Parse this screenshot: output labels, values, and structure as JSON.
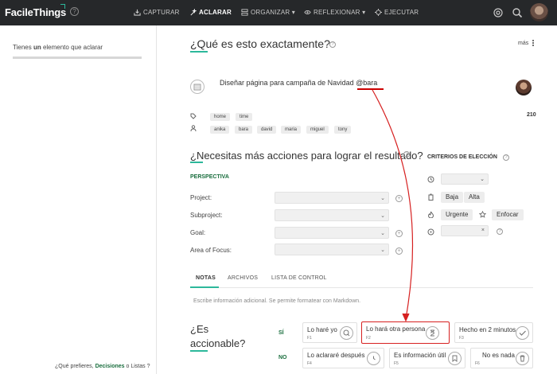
{
  "app": {
    "logo": "FacileThings"
  },
  "nav": {
    "capturar": "CAPTURAR",
    "aclarar": "ACLARAR",
    "organizar": "ORGANIZAR",
    "reflexionar": "REFLEXIONAR",
    "ejecutar": "EJECUTAR"
  },
  "sidebar": {
    "msg_pre": "Tienes ",
    "msg_bold": "un",
    "msg_post": " elemento que aclarar",
    "foot_pre": "¿Qué prefieres, ",
    "foot_decisiones": "Decisiones",
    "foot_mid": " o ",
    "foot_listas": "Listas",
    "foot_post": " ?"
  },
  "main": {
    "heading": "¿Qué es esto exactamente?",
    "more": "más",
    "task": "Diseñar página para campaña de Navidad @bara",
    "contexts": [
      "home",
      "time"
    ],
    "people": [
      "anika",
      "bara",
      "david",
      "maria",
      "miguel",
      "tony"
    ],
    "count": "210",
    "actions_heading": "¿Necesitas más acciones para lograr el resultado?",
    "perspective": "PERSPECTIVA",
    "fields": [
      "Project:",
      "Subproject:",
      "Goal:",
      "Area of Focus:"
    ],
    "criteria": "CRITERIOS DE ELECCIÓN",
    "energy": [
      "Baja",
      "Alta"
    ],
    "priority": [
      "Urgente",
      "Enfocar"
    ],
    "tabs": [
      "NOTAS",
      "ARCHIVOS",
      "LISTA DE CONTROL"
    ],
    "notes_placeholder": "Escribe información adicional. Se permite formatear con Markdown.",
    "actionable_1": "¿Es",
    "actionable_2": "accionable?",
    "yes": "SÍ",
    "no": "NO",
    "cards": [
      {
        "title": "Lo haré yo",
        "key": "F1"
      },
      {
        "title": "Lo hará otra persona",
        "key": "F2"
      },
      {
        "title": "Hecho en 2 minutos",
        "key": "F3"
      },
      {
        "title": "Lo aclararé después",
        "key": "F4"
      },
      {
        "title": "Es información útil",
        "key": "F5"
      },
      {
        "title": "No es nada",
        "key": "F6"
      }
    ]
  },
  "colors": {
    "topbar": "#26282a",
    "accent": "#2db89b",
    "green": "#1a6e3e",
    "highlight": "#d62020"
  }
}
